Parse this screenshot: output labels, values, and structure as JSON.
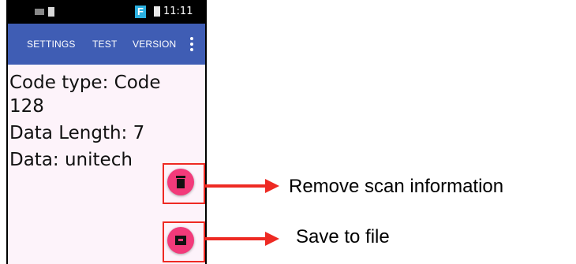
{
  "status_bar": {
    "time": "11:11",
    "app_badge": "F"
  },
  "app_bar": {
    "tabs": [
      "SETTINGS",
      "TEST",
      "VERSION"
    ]
  },
  "scan_info": {
    "lines": [
      "Code type: Code",
      "128",
      "Data Length: 7",
      "Data: unitech"
    ]
  },
  "annotations": {
    "remove": "Remove scan information",
    "save": "Save to file"
  },
  "colors": {
    "app_bar": "#3f5db4",
    "fab": "#f23a7a",
    "annotation": "#ee2a23"
  }
}
